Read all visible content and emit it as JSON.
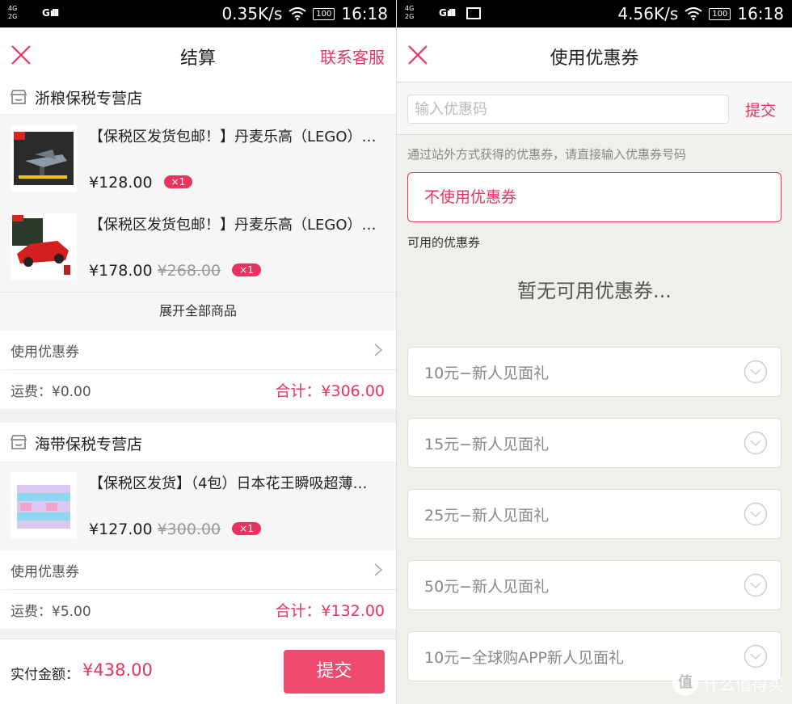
{
  "colors": {
    "accent": "#e8335f",
    "submit_bg": "#f04a6f"
  },
  "left": {
    "status": {
      "net_top": "4G",
      "net_bottom": "2G",
      "carrier": "G",
      "speed": "0.35K/s",
      "battery": "100",
      "time": "16:18"
    },
    "nav": {
      "title": "结算",
      "right_label": "联系客服"
    },
    "stores": [
      {
        "name": "浙粮保税专营店",
        "products": [
          {
            "title": "【保税区发货包邮！】丹麦乐高（LEGO）机械组",
            "price": "¥128.00",
            "old_price": "",
            "qty": "×1",
            "thumb_icon": "lego-plane-thumbnail"
          },
          {
            "title": "【保税区发货包邮！】丹麦乐高（LEGO）超级赛车",
            "price": "¥178.00",
            "old_price": "¥268.00",
            "qty": "×1",
            "thumb_icon": "lego-car-thumbnail"
          }
        ],
        "expand_label": "展开全部商品",
        "coupon_label": "使用优惠券",
        "shipping": "运费：¥0.00",
        "total": "合计：¥306.00"
      },
      {
        "name": "海带保税专营店",
        "products": [
          {
            "title": "【保税区发货】（4包）日本花王瞬吸超薄日用",
            "price": "¥127.00",
            "old_price": "¥300.00",
            "qty": "×1",
            "thumb_icon": "diaper-pack-thumbnail"
          }
        ],
        "coupon_label": "使用优惠券",
        "shipping": "运费：¥5.00",
        "total": "合计：¥132.00"
      }
    ],
    "bottom": {
      "pay_label": "实付金额：",
      "pay_amount": "¥438.00",
      "submit_label": "提交"
    }
  },
  "right": {
    "status": {
      "net_top": "4G",
      "net_bottom": "2G",
      "carrier": "G",
      "speed": "4.56K/s",
      "battery": "100",
      "time": "16:18"
    },
    "nav": {
      "title": "使用优惠券"
    },
    "code_input": {
      "placeholder": "输入优惠码",
      "value": ""
    },
    "code_submit": "提交",
    "hint": "通过站外方式获得的优惠券，请直接输入优惠券号码",
    "no_coupon": "不使用优惠券",
    "available_label": "可用的优惠券",
    "empty_message": "暂无可用优惠券...",
    "coupons": [
      {
        "label": "10元−新人见面礼"
      },
      {
        "label": "15元−新人见面礼"
      },
      {
        "label": "25元−新人见面礼"
      },
      {
        "label": "50元−新人见面礼"
      },
      {
        "label": "10元−全球购APP新人见面礼"
      }
    ]
  },
  "watermark": {
    "text": "什么值得买",
    "icon": "值"
  }
}
